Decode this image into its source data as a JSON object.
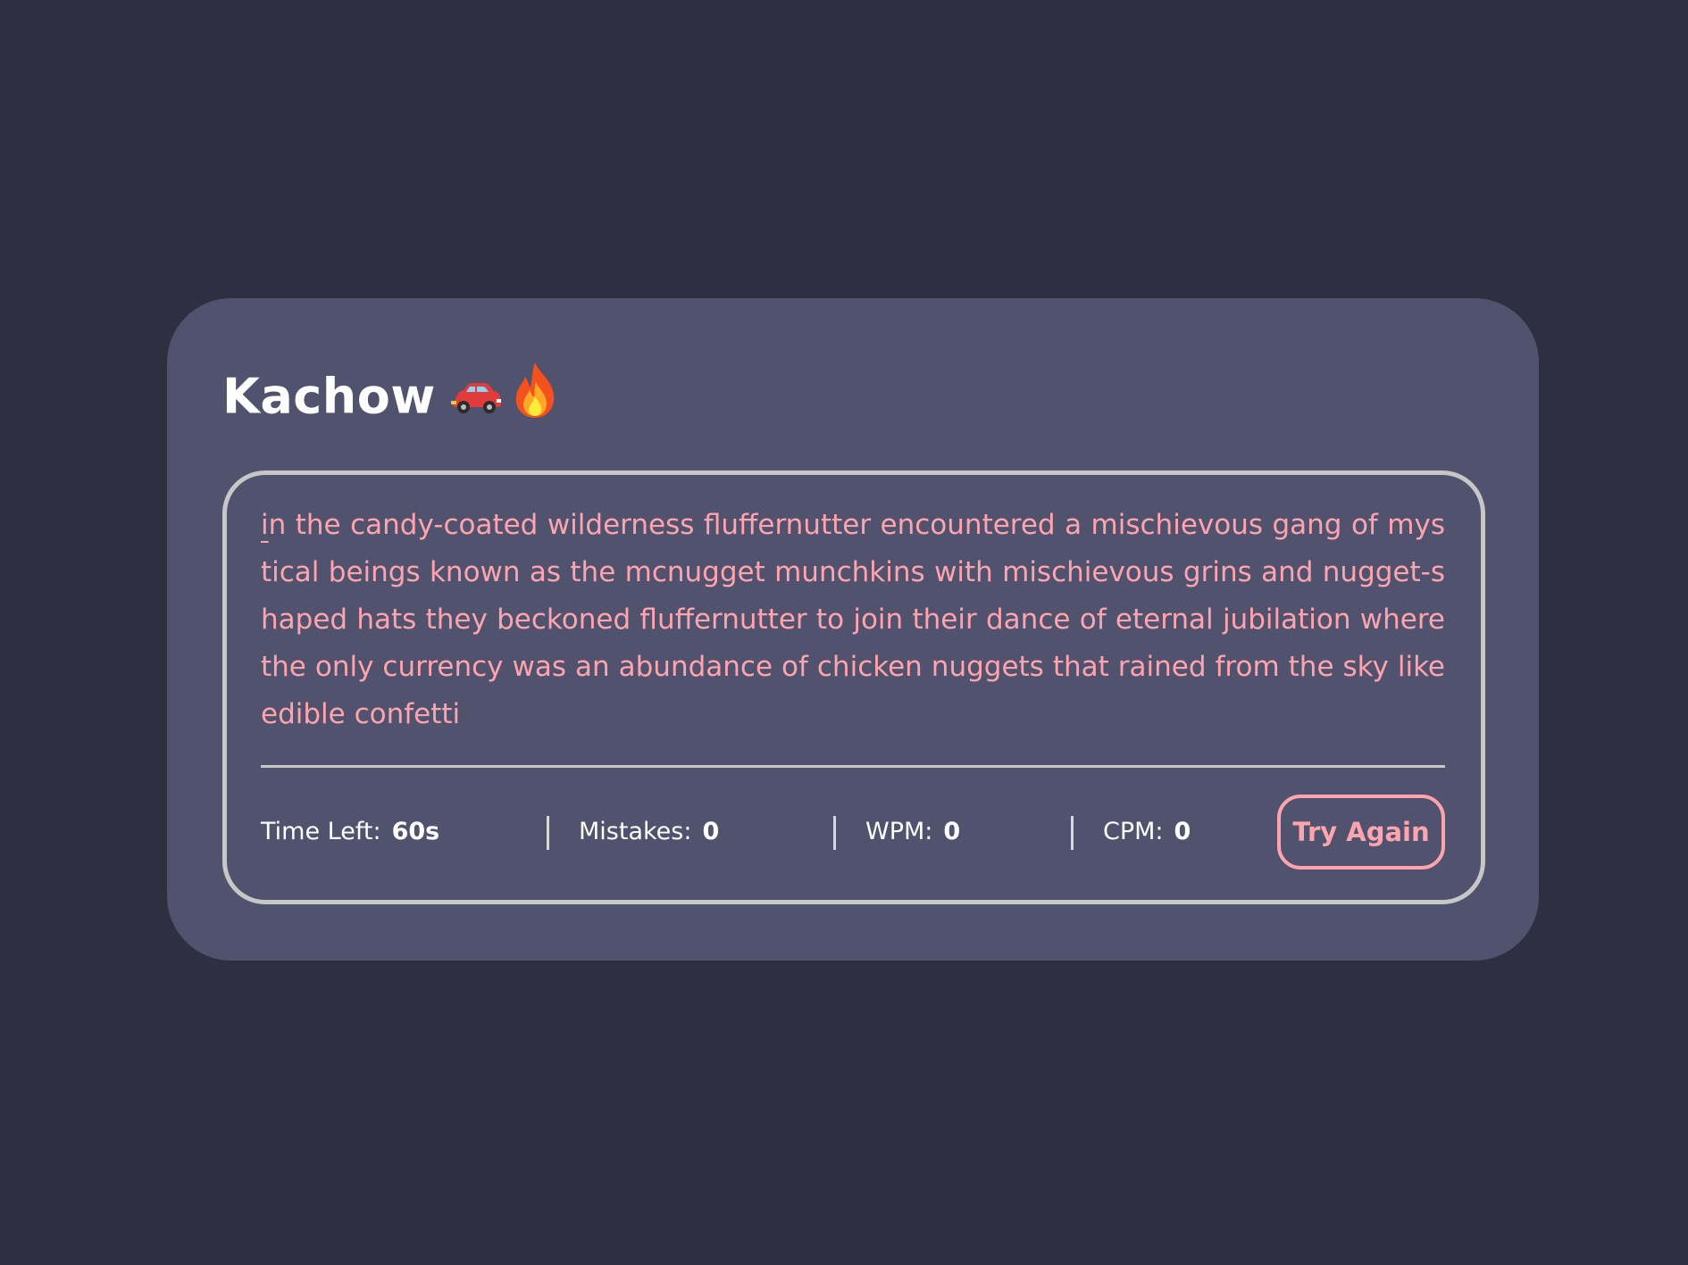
{
  "app": {
    "title": "Kachow",
    "icons": [
      "car-icon",
      "fire-icon"
    ]
  },
  "paragraph": {
    "first_char": "i",
    "rest": "n the candy-coated wilderness fluffernutter encountered a mischievous gang of mystical beings known as the mcnugget munchkins with mischievous grins and nugget-shaped hats they beckoned fluffernutter to join their dance of eternal jubilation where the only currency was an abundance of chicken nuggets that rained from the sky like edible confetti"
  },
  "stats": {
    "time_left_label": "Time Left:",
    "time_left_value": "60s",
    "mistakes_label": "Mistakes:",
    "mistakes_value": "0",
    "wpm_label": "WPM:",
    "wpm_value": "0",
    "cpm_label": "CPM:",
    "cpm_value": "0"
  },
  "actions": {
    "try_again_label": "Try Again"
  },
  "colors": {
    "background": "#2f2f42",
    "card": "#51526e",
    "text_accent": "#fda4af",
    "border": "#c7c7c7"
  }
}
